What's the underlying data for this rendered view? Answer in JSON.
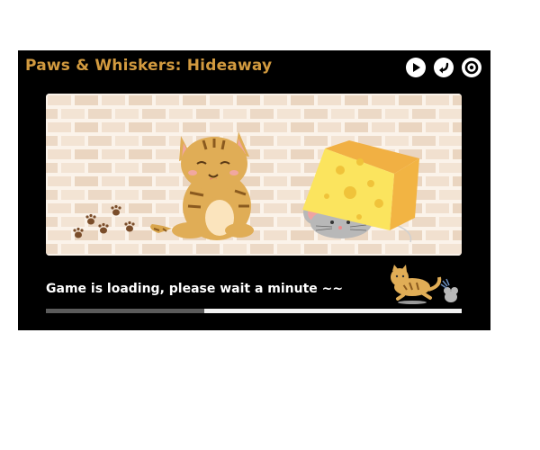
{
  "window": {
    "title": "Paws & Whiskers: Hideaway"
  },
  "controls": [
    {
      "name": "play-icon"
    },
    {
      "name": "back-arrow-icon"
    },
    {
      "name": "settings-icon"
    }
  ],
  "loading": {
    "message": "Game is loading, please wait a minute ~~",
    "progress": 0.38
  },
  "colors": {
    "title": "#d29a3f",
    "frame": "#000000",
    "progress_fill": "#5b5b5b",
    "progress_track": "#f2f2f2"
  }
}
